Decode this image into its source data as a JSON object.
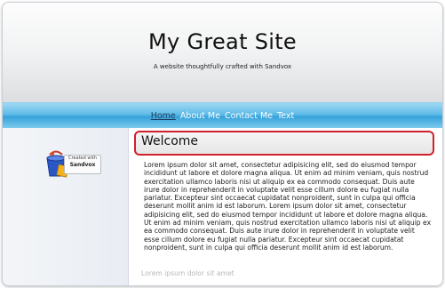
{
  "header": {
    "title": "My Great Site",
    "tagline": "A website thoughtfully crafted with Sandvox"
  },
  "nav": {
    "items": [
      "Home",
      "About Me",
      "Contact Me",
      "Text"
    ],
    "current_index": 0
  },
  "sidebar": {
    "badge_line1": "Created with",
    "badge_line2": "Sandvox"
  },
  "main": {
    "page_heading": "Welcome",
    "paragraph": "Lorem ipsum dolor sit amet, consectetur adipisicing elit, sed do eiusmod tempor incididunt ut labore et dolore magna aliqua. Ut enim ad minim veniam, quis nostrud exercitation ullamco laboris nisi ut aliquip ex ea commodo consequat. Duis aute irure dolor in reprehenderit in voluptate velit esse cillum dolore eu fugiat nulla pariatur. Excepteur sint occaecat cupidatat nonproident, sunt in culpa qui officia deserunt mollit anim id est laborum. Lorem ipsum dolor sit amet, consectetur adipisicing elit, sed do eiusmod tempor incididunt ut labore et dolore magna aliqua. Ut enim ad minim veniam, quis nostrud exercitation ullamco laboris nisi ut aliquip ex ea commodo consequat. Duis aute irure dolor in reprehenderit in voluptate velit esse cillum dolore eu fugiat nulla pariatur. Excepteur sint occaecat cupidatat nonproident, sunt in culpa qui officia deserunt mollit anim id est laborum.",
    "cutoff_text": "Lorem ipsum dolor sit amet"
  },
  "colors": {
    "nav_blue": "#36a2da",
    "highlight_red": "#d0202a"
  }
}
